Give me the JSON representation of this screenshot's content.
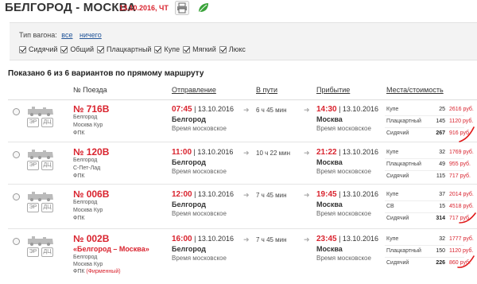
{
  "header": {
    "route": "БЕЛГОРОД - МОСКВА",
    "date": "13.10.2016, ЧТ",
    "icons": [
      "print-icon",
      "eco-leaf-icon"
    ]
  },
  "filter": {
    "label": "Тип вагона:",
    "link_all": "все",
    "link_none": "ничего",
    "options": [
      "Сидячий",
      "Общий",
      "Плацкартный",
      "Купе",
      "Мягкий",
      "Люкс"
    ]
  },
  "shown_text": "Показано 6 из 6 вариантов по прямому маршруту",
  "columns": {
    "train": "№ Поезда",
    "departure": "Отправление",
    "transit": "В пути",
    "arrival": "Прибытие",
    "seats": "Места/стоимость"
  },
  "badges": {
    "er": "ЭР",
    "dc": "ДЦ"
  },
  "timezone": "Время московское",
  "trains": [
    {
      "number": "№ 716В",
      "name": "",
      "route_from": "Белгород",
      "route_to": "Москва Кур",
      "carrier": "ФПК",
      "carrier_brand": "",
      "dep_time": "07:45",
      "dep_date": " | 13.10.2016",
      "dep_station": "Белгород",
      "duration": "6 ч 45 мин",
      "arr_time": "14:30",
      "arr_date": " | 13.10.2016",
      "arr_station": "Москва",
      "seats": [
        {
          "type": "Купе",
          "count": "25",
          "price": "2616 руб."
        },
        {
          "type": "Плацкартный",
          "count": "145",
          "price": "1120 руб."
        },
        {
          "type": "Сидячий",
          "count": "267",
          "price": "916 руб."
        }
      ]
    },
    {
      "number": "№ 120В",
      "name": "",
      "route_from": "Белгород",
      "route_to": "С-Пет-Лад",
      "carrier": "ФПК",
      "carrier_brand": "",
      "dep_time": "11:00",
      "dep_date": " | 13.10.2016",
      "dep_station": "Белгород",
      "duration": "10 ч 22 мин",
      "arr_time": "21:22",
      "arr_date": " | 13.10.2016",
      "arr_station": "Москва",
      "seats": [
        {
          "type": "Купе",
          "count": "32",
          "price": "1769 руб."
        },
        {
          "type": "Плацкартный",
          "count": "49",
          "price": "955 руб."
        },
        {
          "type": "Сидячий",
          "count": "115",
          "price": "717 руб."
        }
      ]
    },
    {
      "number": "№ 006В",
      "name": "",
      "route_from": "Белгород",
      "route_to": "Москва Кур",
      "carrier": "ФПК",
      "carrier_brand": "",
      "dep_time": "12:00",
      "dep_date": " | 13.10.2016",
      "dep_station": "Белгород",
      "duration": "7 ч 45 мин",
      "arr_time": "19:45",
      "arr_date": " | 13.10.2016",
      "arr_station": "Москва",
      "seats": [
        {
          "type": "Купе",
          "count": "37",
          "price": "2014 руб."
        },
        {
          "type": "СВ",
          "count": "15",
          "price": "4518 руб."
        },
        {
          "type": "Сидячий",
          "count": "314",
          "price": "717 руб."
        }
      ]
    },
    {
      "number": "№ 002В",
      "name": "«Белгород – Москва»",
      "route_from": "Белгород",
      "route_to": "Москва Кур",
      "carrier": "ФПК",
      "carrier_brand": "(Фирменный)",
      "dep_time": "16:00",
      "dep_date": " | 13.10.2016",
      "dep_station": "Белгород",
      "duration": "7 ч 45 мин",
      "arr_time": "23:45",
      "arr_date": " | 13.10.2016",
      "arr_station": "Москва",
      "seats": [
        {
          "type": "Купе",
          "count": "32",
          "price": "1777 руб."
        },
        {
          "type": "Плацкартный",
          "count": "150",
          "price": "1120 руб."
        },
        {
          "type": "Сидячий",
          "count": "226",
          "price": "860 руб."
        }
      ]
    }
  ],
  "colors": {
    "accent_red": "#d9232e",
    "link_blue": "#225599",
    "filter_bg": "#f3f3f3"
  }
}
